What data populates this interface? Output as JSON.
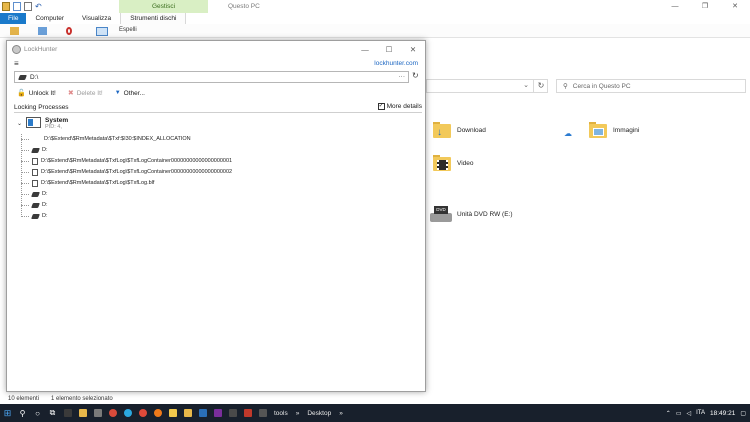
{
  "explorer": {
    "ribbon": {
      "context_group": "Gestisci",
      "window_title": "Questo PC",
      "tabs": [
        "File",
        "Computer",
        "Visualizza",
        "Strumenti dischi"
      ],
      "eject_label": "Espelli",
      "window_controls": {
        "minimize": "—",
        "maximize": "❐",
        "close": "✕"
      }
    },
    "search_placeholder": "Cerca in Questo PC",
    "items": [
      {
        "label": "Download",
        "icon": "download-folder-icon"
      },
      {
        "label": "Immagini",
        "icon": "pictures-folder-icon"
      },
      {
        "label": "Video",
        "icon": "video-folder-icon"
      },
      {
        "label": "Unità DVD RW (E:)",
        "icon": "dvd-drive-icon"
      }
    ],
    "status": {
      "count": "10 elementi",
      "selection": "1 elemento selezionato"
    }
  },
  "lockhunter": {
    "title": "LockHunter",
    "window_controls": {
      "minimize": "—",
      "maximize": "☐",
      "close": "✕"
    },
    "menu_glyph": "≡",
    "site_link": "lockhunter.com",
    "path": "D:\\",
    "path_more": "···",
    "actions": {
      "unlock": "Unlock It!",
      "delete": "Delete It!",
      "other": "Other..."
    },
    "list_header": "Locking Processes",
    "more_details_label": "More details",
    "more_details_checked": true,
    "process": {
      "name": "System",
      "pid": "PID: 4,"
    },
    "locked_items": [
      {
        "text": "D:\\$Extend\\$RmMetadata\\$Txf:$I30:$INDEX_ALLOCATION",
        "icon": "none"
      },
      {
        "text": "D:",
        "icon": "drive"
      },
      {
        "text": "D:\\$Extend\\$RmMetadata\\$TxfLog\\$TxfLogContainer00000000000000000001",
        "icon": "file"
      },
      {
        "text": "D:\\$Extend\\$RmMetadata\\$TxfLog\\$TxfLogContainer00000000000000000002",
        "icon": "file"
      },
      {
        "text": "D:\\$Extend\\$RmMetadata\\$TxfLog\\$TxfLog.blf",
        "icon": "file"
      },
      {
        "text": "D:",
        "icon": "drive"
      },
      {
        "text": "D:",
        "icon": "drive"
      },
      {
        "text": "D:",
        "icon": "drive"
      }
    ]
  },
  "taskbar": {
    "tools_label": "tools",
    "desktop_label": "Desktop",
    "language": "ITA",
    "time": "18:49:21",
    "chevron": "»"
  },
  "colors": {
    "accent": "#1979ca",
    "link": "#1d67c2",
    "taskbar": "#18202c",
    "context_tab": "#d9efc4"
  }
}
